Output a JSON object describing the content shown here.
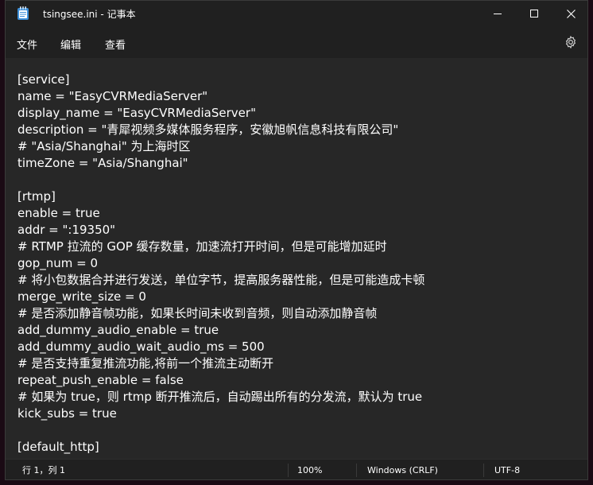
{
  "window": {
    "title": "tsingsee.ini - 记事本"
  },
  "menu": {
    "file": "文件",
    "edit": "编辑",
    "view": "查看"
  },
  "editor": {
    "lines": [
      "[service]",
      "name = \"EasyCVRMediaServer\"",
      "display_name = \"EasyCVRMediaServer\"",
      "description = \"青犀视频多媒体服务程序，安徽旭帆信息科技有限公司\"",
      "# \"Asia/Shanghai\" 为上海时区",
      "timeZone = \"Asia/Shanghai\"",
      "",
      "[rtmp]",
      "enable = true",
      "addr = \":19350\"",
      "# RTMP 拉流的 GOP 缓存数量，加速流打开时间，但是可能增加延时",
      "gop_num = 0",
      "# 将小包数据合并进行发送，单位字节，提高服务器性能，但是可能造成卡顿",
      "merge_write_size = 0",
      "# 是否添加静音帧功能，如果长时间未收到音频，则自动添加静音帧",
      "add_dummy_audio_enable = true",
      "add_dummy_audio_wait_audio_ms = 500",
      "# 是否支持重复推流功能,将前一个推流主动断开",
      "repeat_push_enable = false",
      "# 如果为 true，则 rtmp 断开推流后，自动踢出所有的分发流，默认为 true",
      "kick_subs = true",
      "",
      "[default_http]"
    ]
  },
  "status": {
    "position": "行 1，列 1",
    "zoom": "100%",
    "line_ending": "Windows (CRLF)",
    "encoding": "UTF-8"
  }
}
